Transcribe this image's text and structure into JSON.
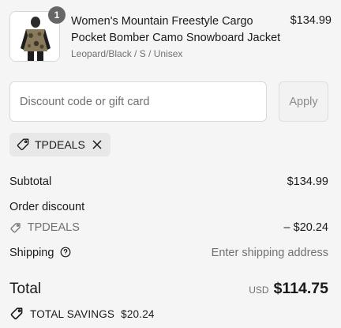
{
  "line_item": {
    "quantity": "1",
    "title": "Women's Mountain Freestyle Cargo Pocket Bomber Camo Snowboard Jacket",
    "variant": "Leopard/Black / S / Unisex",
    "price": "$134.99",
    "thumbnail_icon": "jacket-product-photo"
  },
  "discount": {
    "placeholder": "Discount code or gift card",
    "value": "",
    "apply_label": "Apply",
    "applied_code": "TPDEALS"
  },
  "summary": {
    "subtotal_label": "Subtotal",
    "subtotal_value": "$134.99",
    "order_discount_label": "Order discount",
    "discount_code": "TPDEALS",
    "discount_value": "– $20.24",
    "shipping_label": "Shipping",
    "shipping_value": "Enter shipping address",
    "total_label": "Total",
    "currency": "USD",
    "total_value": "$114.75",
    "savings_label": "TOTAL SAVINGS",
    "savings_value": "$20.24"
  },
  "colors": {
    "background": "#f5f5f5",
    "text": "#1a1a1a",
    "muted": "#707070",
    "badge": "#666666"
  }
}
